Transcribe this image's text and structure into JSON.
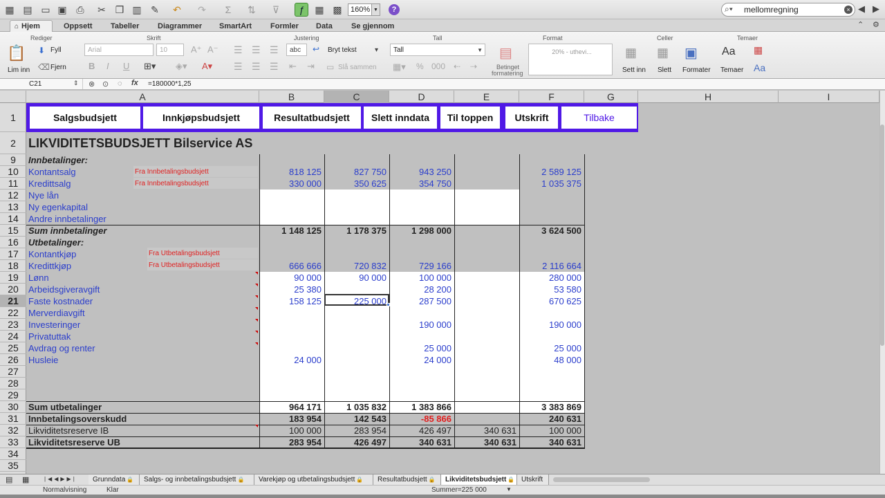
{
  "toolbar": {
    "zoom": "160%",
    "help_icon": "?",
    "search_value": "mellomregning"
  },
  "ribbon_tabs": [
    "Hjem",
    "Oppsett",
    "Tabeller",
    "Diagrammer",
    "SmartArt",
    "Formler",
    "Data",
    "Se gjennom"
  ],
  "ribbon": {
    "groups": {
      "rediger": "Rediger",
      "skrift": "Skrift",
      "justering": "Justering",
      "tall": "Tall",
      "format": "Format",
      "celler": "Celler",
      "temaer": "Temaer"
    },
    "paste_label": "Lim inn",
    "fill_label": "Fyll",
    "clear_label": "Fjern",
    "font_name": "Arial",
    "font_size": "10",
    "wrap_label": "Bryt tekst",
    "abc_label": "abc",
    "merge_label": "Slå sammen",
    "number_format": "Tall",
    "cond_format_label_1": "Betinget",
    "cond_format_label_2": "formatering",
    "style_preview": "20% - uthevi...",
    "insert_label": "Sett inn",
    "delete_label": "Slett",
    "format_label": "Formater",
    "themes_label": "Temaer",
    "aa_label": "Aa"
  },
  "formula_bar": {
    "cell_ref": "C21",
    "fx": "fx",
    "formula": "=180000*1,25"
  },
  "columns": [
    "A",
    "B",
    "C",
    "D",
    "E",
    "F",
    "G",
    "H",
    "I"
  ],
  "row_numbers": [
    "1",
    "2",
    "9",
    "10",
    "11",
    "12",
    "13",
    "14",
    "15",
    "16",
    "17",
    "18",
    "19",
    "20",
    "21",
    "22",
    "23",
    "24",
    "25",
    "26",
    "27",
    "28",
    "29",
    "30",
    "31",
    "32",
    "33",
    "34",
    "35"
  ],
  "nav_buttons": [
    "Salgsbudsjett",
    "Innkjøpsbudsjett",
    "Resultatbudsjett",
    "Slett inndata",
    "Til toppen",
    "Utskrift",
    "Tilbake"
  ],
  "sheet_title": "LIKVIDITETSBUDSJETT Bilservice AS",
  "notes": {
    "innbetaling": "Fra Innbetalingsbudsjett",
    "utbetaling": "Fra Utbetalingsbudsjett"
  },
  "rows": [
    {
      "label": "Innbetalinger:",
      "style": "bi",
      "values": [
        "",
        "",
        "",
        "",
        ""
      ]
    },
    {
      "label": "Kontantsalg",
      "style": "blue",
      "values": [
        "818 125",
        "827 750",
        "943 250",
        "",
        "2 589 125"
      ]
    },
    {
      "label": "Kredittsalg",
      "style": "blue",
      "values": [
        "330 000",
        "350 625",
        "354 750",
        "",
        "1 035 375"
      ]
    },
    {
      "label": "Nye lån",
      "style": "blue",
      "values": [
        "",
        "",
        "",
        "",
        ""
      ]
    },
    {
      "label": "Ny egenkapital",
      "style": "blue",
      "values": [
        "",
        "",
        "",
        "",
        ""
      ]
    },
    {
      "label": "Andre innbetalinger",
      "style": "blue",
      "values": [
        "",
        "",
        "",
        "",
        ""
      ]
    },
    {
      "label": "Sum innbetalinger",
      "style": "bi",
      "values": [
        "1 148 125",
        "1 178 375",
        "1 298 000",
        "",
        "3 624 500"
      ]
    },
    {
      "label": "Utbetalinger:",
      "style": "bi",
      "values": [
        "",
        "",
        "",
        "",
        ""
      ]
    },
    {
      "label": "Kontantkjøp",
      "style": "blue",
      "values": [
        "",
        "",
        "",
        "",
        ""
      ]
    },
    {
      "label": "Kredittkjøp",
      "style": "blue",
      "values": [
        "666 666",
        "720 832",
        "729 166",
        "",
        "2 116 664"
      ]
    },
    {
      "label": "Lønn",
      "style": "blue",
      "values": [
        "90 000",
        "90 000",
        "100 000",
        "",
        "280 000"
      ]
    },
    {
      "label": "Arbeidsgiveravgift",
      "style": "blue",
      "values": [
        "25 380",
        "",
        "28 200",
        "",
        "53 580"
      ]
    },
    {
      "label": "Faste kostnader",
      "style": "blue",
      "values": [
        "158 125",
        "225 000",
        "287 500",
        "",
        "670 625"
      ]
    },
    {
      "label": "Merverdiavgift",
      "style": "blue",
      "values": [
        "",
        "",
        "",
        "",
        ""
      ]
    },
    {
      "label": "Investeringer",
      "style": "blue",
      "values": [
        "",
        "",
        "190 000",
        "",
        "190 000"
      ]
    },
    {
      "label": "Privatuttak",
      "style": "blue",
      "values": [
        "",
        "",
        "",
        "",
        ""
      ]
    },
    {
      "label": "Avdrag og renter",
      "style": "blue",
      "values": [
        "",
        "",
        "25 000",
        "",
        "25 000"
      ]
    },
    {
      "label": "Husleie",
      "style": "blue",
      "values": [
        "24 000",
        "",
        "24 000",
        "",
        "48 000"
      ]
    },
    {
      "label": "",
      "style": "blue",
      "values": [
        "",
        "",
        "",
        "",
        ""
      ]
    },
    {
      "label": "",
      "style": "blue",
      "values": [
        "",
        "",
        "",
        "",
        ""
      ]
    },
    {
      "label": "",
      "style": "blue",
      "values": [
        "",
        "",
        "",
        "",
        ""
      ]
    },
    {
      "label": "Sum utbetalinger",
      "style": "b",
      "values": [
        "964 171",
        "1 035 832",
        "1 383 866",
        "",
        "3 383 869"
      ]
    },
    {
      "label": "Innbetalingsoverskudd",
      "style": "b",
      "values": [
        "183 954",
        "142 543",
        "-85 866",
        "",
        "240 631"
      ]
    },
    {
      "label": "Likviditetsreserve IB",
      "style": "plain",
      "values": [
        "100 000",
        "283 954",
        "426 497",
        "340 631",
        "100 000"
      ]
    },
    {
      "label": "Likviditetsreserve UB",
      "style": "b",
      "values": [
        "283 954",
        "426 497",
        "340 631",
        "340 631",
        "340 631"
      ]
    },
    {
      "label": "",
      "style": "blue",
      "values": [
        "",
        "",
        "",
        "",
        ""
      ]
    },
    {
      "label": "",
      "style": "blue",
      "values": [
        "",
        "",
        "",
        "",
        ""
      ]
    }
  ],
  "sheet_tabs": [
    "Grunndata",
    "Salgs- og innbetalingsbudsjett",
    "Varekjøp og utbetalingsbudsjett",
    "Resultatbudsjett",
    "Likviditetsbudsjett",
    "Utskrift"
  ],
  "status": {
    "view": "Normalvisning",
    "ready": "Klar",
    "sum": "Summer=225 000"
  },
  "colors": {
    "nav_bar": "#5019e6",
    "input_blue": "#2a3dcc",
    "negative_red": "#e02020"
  }
}
